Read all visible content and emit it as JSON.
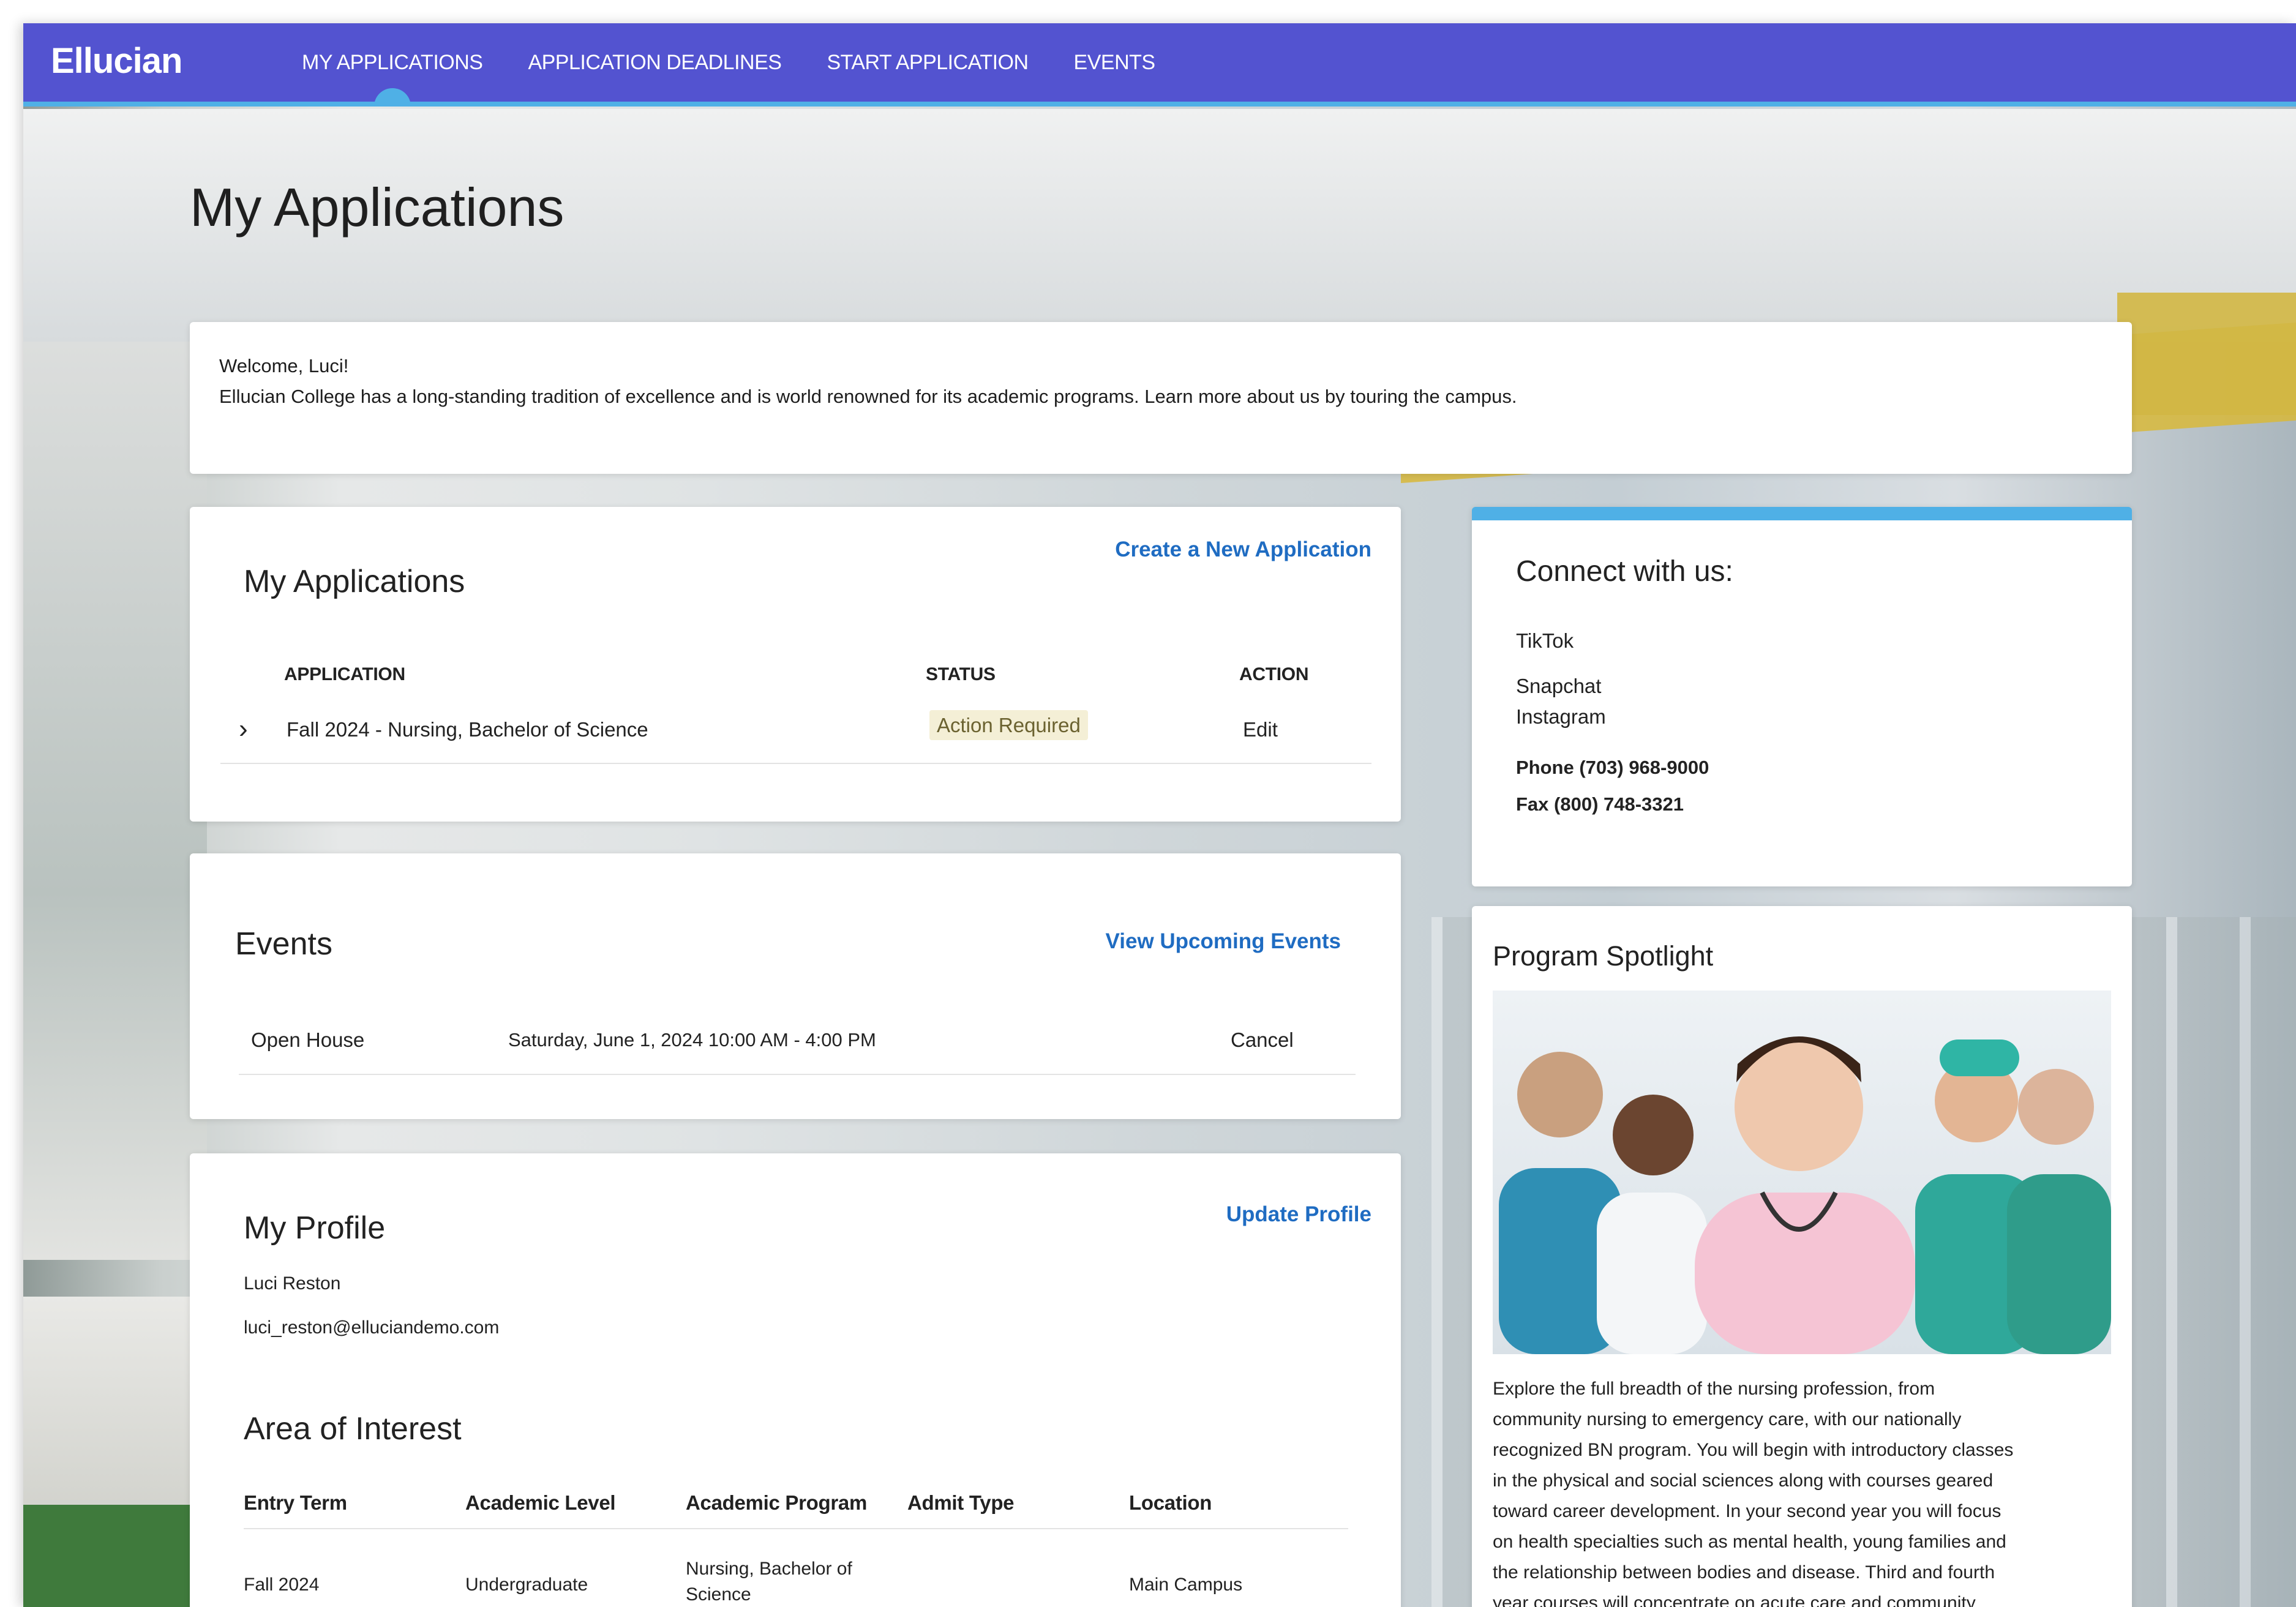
{
  "brand": {
    "logo_text": "Ellucian"
  },
  "nav": {
    "items": [
      {
        "label": "MY APPLICATIONS",
        "active": true
      },
      {
        "label": "APPLICATION DEADLINES"
      },
      {
        "label": "START APPLICATION"
      },
      {
        "label": "EVENTS"
      }
    ]
  },
  "page": {
    "title": "My Applications"
  },
  "welcome": {
    "greeting": "Welcome, Luci!",
    "message": "Ellucian College has a long-standing tradition of excellence and is world renowned for its academic programs. Learn more about us by touring the campus."
  },
  "applications": {
    "title": "My Applications",
    "create_link": "Create a New Application",
    "headers": {
      "application": "APPLICATION",
      "status": "STATUS",
      "action": "ACTION"
    },
    "rows": [
      {
        "name": "Fall 2024 - Nursing, Bachelor of Science",
        "status": "Action Required",
        "action": "Edit"
      }
    ]
  },
  "events": {
    "title": "Events",
    "view_link": "View Upcoming Events",
    "rows": [
      {
        "name": "Open House",
        "datetime": "Saturday, June 1, 2024 10:00 AM - 4:00 PM",
        "action": "Cancel"
      }
    ]
  },
  "profile": {
    "title": "My Profile",
    "update_link": "Update Profile",
    "name": "Luci Reston",
    "email": "luci_reston@elluciandemo.com",
    "interest": {
      "title": "Area of Interest",
      "headers": [
        "Entry Term",
        "Academic Level",
        "Academic Program",
        "Admit Type",
        "Location"
      ],
      "rows": [
        {
          "entry_term": "Fall 2024",
          "level": "Undergraduate",
          "program_line1": "Nursing, Bachelor of",
          "program_line2": "Science",
          "admit_type": "",
          "location": "Main Campus"
        }
      ]
    }
  },
  "connect": {
    "title": "Connect with us:",
    "links": [
      "TikTok",
      "Snapchat",
      "Instagram"
    ],
    "phone": "Phone (703) 968-9000",
    "fax": "Fax (800) 748-3321"
  },
  "spotlight": {
    "title": "Program Spotlight",
    "lines": [
      "Explore the full breadth of the nursing profession, from",
      "community nursing to emergency care, with our nationally",
      "recognized BN program. You will begin with introductory classes",
      "in the physical and social sciences along with courses geared",
      "toward career development. In your second year you will focus",
      "on health specialties such as mental health, young families and",
      "the relationship between bodies and disease. Third and fourth",
      "year courses will concentrate on acute care and community"
    ]
  },
  "colors": {
    "nav_bg": "#5353d0",
    "accent": "#4fb0e6",
    "link": "#1f6cc2",
    "badge_bg": "#f4efd6"
  }
}
